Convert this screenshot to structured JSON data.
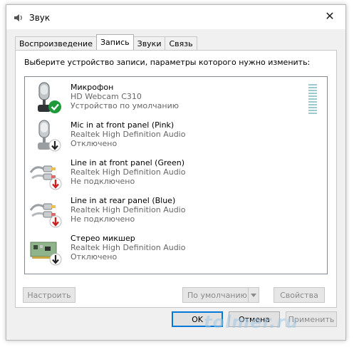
{
  "window": {
    "title": "Звук",
    "close_glyph": "✕"
  },
  "tabs": [
    {
      "label": "Воспроизведение",
      "active": false
    },
    {
      "label": "Запись",
      "active": true
    },
    {
      "label": "Звуки",
      "active": false
    },
    {
      "label": "Связь",
      "active": false
    }
  ],
  "instruction": "Выберите устройство записи, параметры которого нужно изменить:",
  "devices": [
    {
      "name": "Микрофон",
      "driver": "HD Webcam C310",
      "status": "Устройство по умолчанию",
      "icon": "microphone-icon",
      "badge": "default-check-icon",
      "badge_color": "#1e9a3a"
    },
    {
      "name": "Mic in at front panel (Pink)",
      "driver": "Realtek High Definition Audio",
      "status": "Отключено",
      "icon": "microphone-icon",
      "badge": "disabled-arrow-icon",
      "badge_color": "#222222"
    },
    {
      "name": "Line in at front panel (Green)",
      "driver": "Realtek High Definition Audio",
      "status": "Не подключено",
      "icon": "line-in-cable-icon",
      "badge": "unplugged-arrow-icon",
      "badge_color": "#cc1f1f"
    },
    {
      "name": "Line in at rear panel (Blue)",
      "driver": "Realtek High Definition Audio",
      "status": "Не подключено",
      "icon": "line-in-cable-icon",
      "badge": "unplugged-arrow-icon",
      "badge_color": "#cc1f1f"
    },
    {
      "name": "Стерео микшер",
      "driver": "Realtek High Definition Audio",
      "status": "Отключено",
      "icon": "sound-card-icon",
      "badge": "disabled-arrow-icon",
      "badge_color": "#222222"
    }
  ],
  "buttons": {
    "configure": "Настроить",
    "set_default": "По умолчанию",
    "properties": "Свойства",
    "ok": "OK",
    "cancel": "Отмена",
    "apply": "Применить"
  },
  "watermark": "tolmer.ru"
}
